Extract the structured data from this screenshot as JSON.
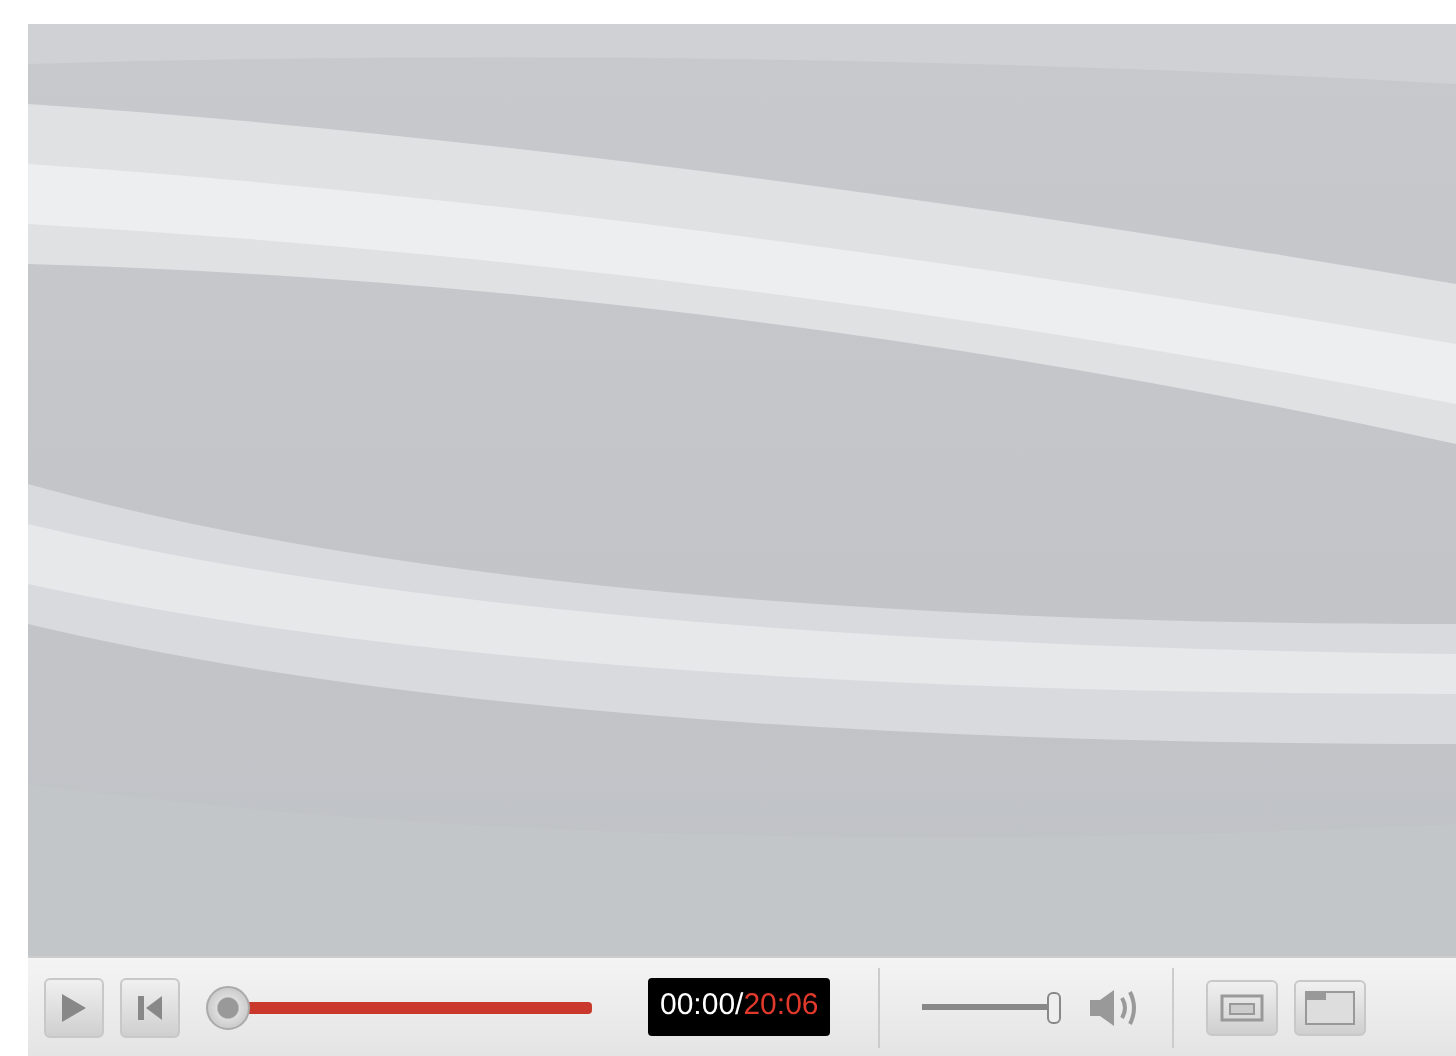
{
  "controls": {
    "progress": {
      "level": 0
    },
    "time": {
      "elapsed": "00:00/",
      "total": "20:06"
    },
    "volume": {
      "level": 1
    }
  }
}
